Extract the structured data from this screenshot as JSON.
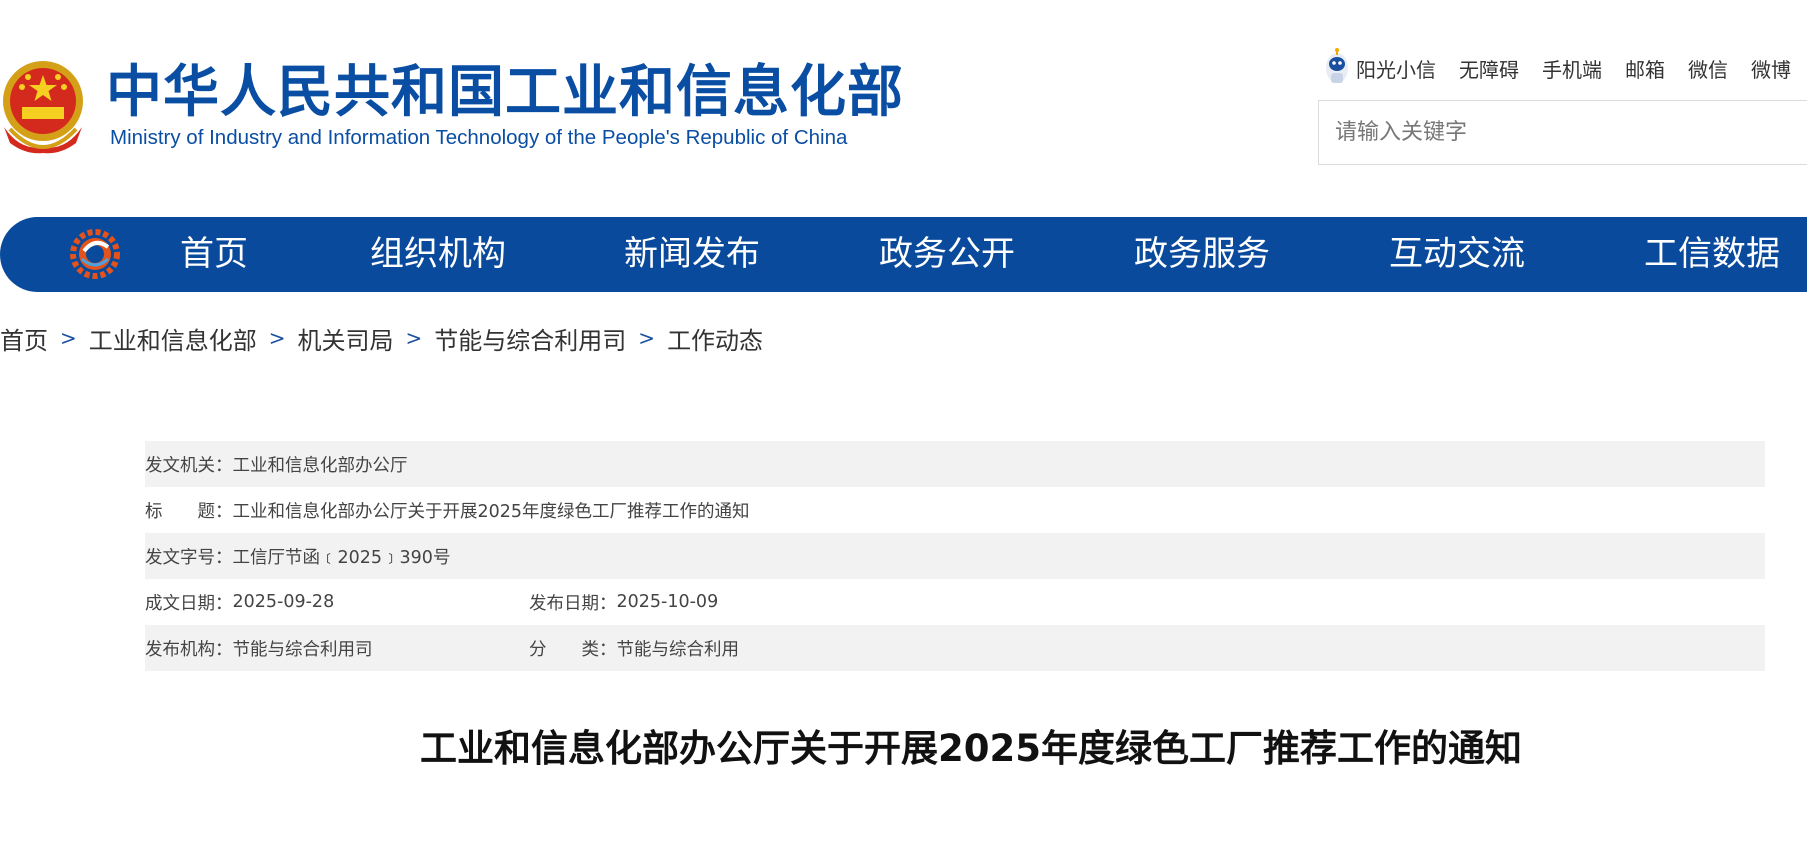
{
  "header": {
    "title_cn": "中华人民共和国工业和信息化部",
    "title_en": "Ministry of Industry and Information Technology of the People's Republic of China",
    "top_links": [
      "阳光小信",
      "无障碍",
      "手机端",
      "邮箱",
      "微信",
      "微博"
    ],
    "search_placeholder": "请输入关键字"
  },
  "nav": {
    "items": [
      "首页",
      "组织机构",
      "新闻发布",
      "政务公开",
      "政务服务",
      "互动交流",
      "工信数据"
    ]
  },
  "breadcrumb": [
    "首页",
    "工业和信息化部",
    "机关司局",
    "节能与综合利用司",
    "工作动态"
  ],
  "breadcrumb_sep": ">",
  "info": {
    "issuer_label": "发文机关：",
    "issuer": "工业和信息化部办公厅",
    "title_label": "标　　题：",
    "title": "工业和信息化部办公厅关于开展2025年度绿色工厂推荐工作的通知",
    "doc_no_label": "发文字号：",
    "doc_no": "工信厅节函﹝2025﹞390号",
    "written_date_label": "成文日期：",
    "written_date": "2025-09-28",
    "publish_date_label": "发布日期：",
    "publish_date": "2025-10-09",
    "publisher_label": "发布机构：",
    "publisher": "节能与综合利用司",
    "category_label": "分　　类：",
    "category": "节能与综合利用"
  },
  "article": {
    "title": "工业和信息化部办公厅关于开展2025年度绿色工厂推荐工作的通知"
  },
  "colors": {
    "brand_blue": "#0a4a9c",
    "logo_blue": "#0a4ea3",
    "row_shade": "#f2f2f2"
  },
  "icons": [
    "national-emblem-icon",
    "robot-assistant-icon",
    "gear-logo-icon"
  ]
}
